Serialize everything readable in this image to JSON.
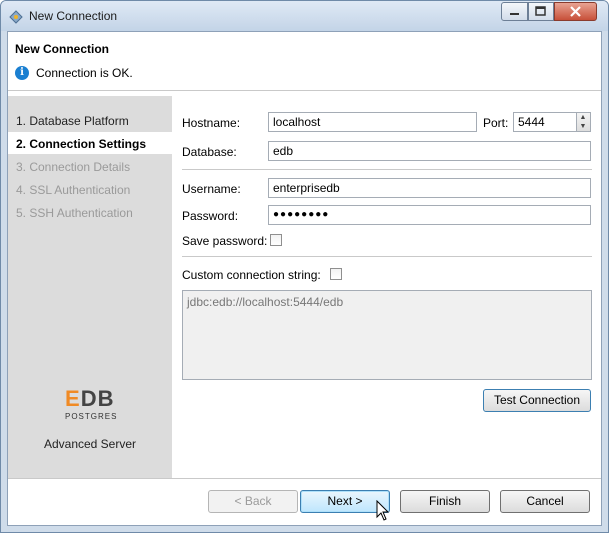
{
  "window": {
    "title": "New Connection"
  },
  "header": {
    "title": "New Connection",
    "message": "Connection is OK."
  },
  "sidebar": {
    "steps": [
      {
        "label": "1. Database Platform",
        "state": "done"
      },
      {
        "label": "2. Connection Settings",
        "state": "active"
      },
      {
        "label": "3. Connection Details",
        "state": "disabled"
      },
      {
        "label": "4. SSL Authentication",
        "state": "disabled"
      },
      {
        "label": "5. SSH Authentication",
        "state": "disabled"
      }
    ],
    "logo": {
      "mark_e": "E",
      "mark_db": "DB",
      "tagline": "POSTGRES",
      "caption": "Advanced Server"
    }
  },
  "form": {
    "hostname_label": "Hostname:",
    "hostname_value": "localhost",
    "port_label": "Port:",
    "port_value": "5444",
    "database_label": "Database:",
    "database_value": "edb",
    "username_label": "Username:",
    "username_value": "enterprisedb",
    "password_label": "Password:",
    "password_value": "●●●●●●●●",
    "save_password_label": "Save password:",
    "custom_string_label": "Custom connection string:",
    "connection_string": "jdbc:edb://localhost:5444/edb",
    "test_button": "Test Connection"
  },
  "footer": {
    "back": "< Back",
    "next": "Next >",
    "finish": "Finish",
    "cancel": "Cancel"
  },
  "colors": {
    "accent": "#1a7fd1",
    "logo_orange": "#f08a24",
    "titlebar": "#c3d4e7"
  }
}
